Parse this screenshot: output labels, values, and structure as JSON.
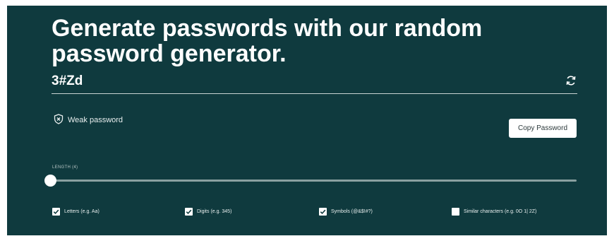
{
  "header": {
    "title_line1": "Generate passwords with our random",
    "title_line2": "password generator."
  },
  "password": {
    "value": "3#Zd",
    "refresh_icon": "refresh-icon"
  },
  "strength": {
    "label": "Weak password",
    "icon": "shield-x-icon"
  },
  "actions": {
    "copy_label": "Copy Password"
  },
  "length": {
    "label": "LENGTH (4)",
    "value": 4
  },
  "options": [
    {
      "label": "Letters (e.g. Aa)",
      "checked": true
    },
    {
      "label": "Digits (e.g. 345)",
      "checked": true
    },
    {
      "label": "Symbols (@&$!#?)",
      "checked": true
    },
    {
      "label": "Similar characters (e.g. 0O 1| 2Z)",
      "checked": false
    }
  ],
  "colors": {
    "panel_bg": "#0f3a3e",
    "text": "#ffffff",
    "track": "#8aa0a0"
  }
}
